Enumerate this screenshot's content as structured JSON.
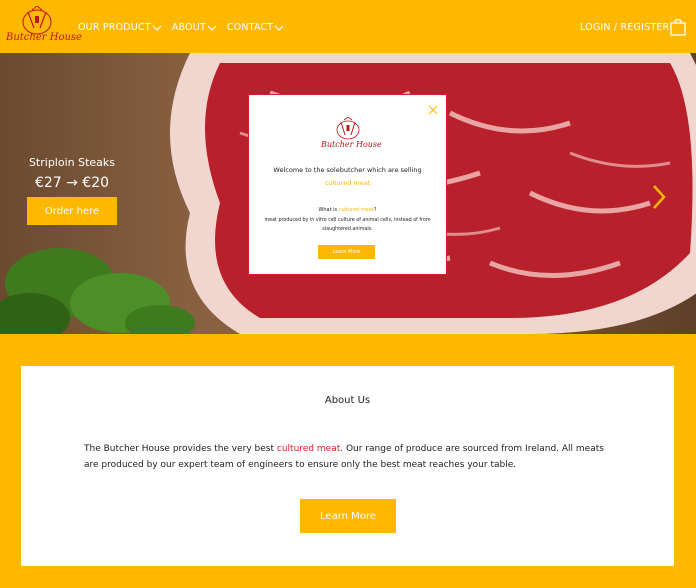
{
  "brand": {
    "name": "Butcher House"
  },
  "nav": {
    "items": [
      {
        "label": "OUR PRODUCT"
      },
      {
        "label": "ABOUT"
      },
      {
        "label": "CONTACT"
      }
    ],
    "login_label": "LOGIN / REGISTER"
  },
  "hero": {
    "title": "Striploin Steaks",
    "price": "€27 → €20",
    "cta_label": "Order here"
  },
  "modal": {
    "welcome": "Welcome to the solebutcher which are selling",
    "cultured": "cultured meat",
    "what_prefix": "What is ",
    "what_highlight": "cultured meat",
    "what_suffix": "?",
    "definition": "meat produced by in vitro cell culture of animal cells, instead of from slaughtered animals.",
    "button_label": "Learn More"
  },
  "about": {
    "title": "About Us",
    "text_before": "The Butcher House provides the very best ",
    "text_highlight": "cultured meat",
    "text_after": ". Our range of produce are sourced from Ireland.  All meats are produced by our expert team of engineers to ensure only the best meat reaches your table.",
    "button_label": "Learn More"
  },
  "colors": {
    "accent": "#FFB800",
    "brand_red": "#C0151B",
    "highlight_red": "#E4202A"
  }
}
